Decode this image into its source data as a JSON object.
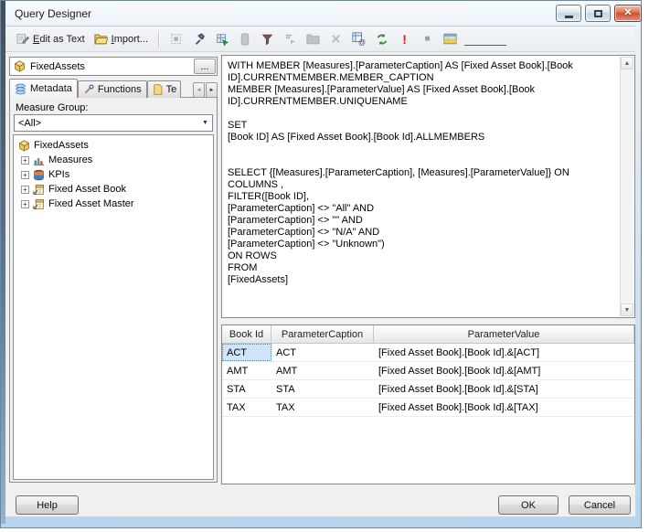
{
  "window": {
    "title": "Query Designer"
  },
  "icons": {
    "close": "✕",
    "plus": "+",
    "dropdown": "▼",
    "up": "▲",
    "down": "▼",
    "left": "◄",
    "right": "►",
    "execute": "!",
    "stop": "■",
    "ellipsis": "..."
  },
  "toolbar": {
    "edit_as_text": "Edit as Text",
    "import": "Import...",
    "icon_names": [
      "edit-as-text-icon",
      "import-folder-icon",
      "design-query-mode-icon",
      "pick-tool-icon",
      "show-empty-cells-icon",
      "add-calculated-member-icon",
      "filter-icon",
      "show-aggregations-icon",
      "group-icon",
      "delete-icon",
      "mdx-cube-icon",
      "refresh-icon",
      "execute-icon",
      "stop-icon",
      "design-mode-icon"
    ]
  },
  "cube_selector": {
    "name": "FixedAssets"
  },
  "tabs": {
    "metadata": "Metadata",
    "functions": "Functions",
    "templates": "Te"
  },
  "measure_group": {
    "label": "Measure Group:",
    "value": "<All>"
  },
  "tree": {
    "root": "FixedAssets",
    "items": [
      {
        "label": "Measures"
      },
      {
        "label": "KPIs"
      },
      {
        "label": "Fixed Asset Book"
      },
      {
        "label": "Fixed Asset Master"
      }
    ]
  },
  "query_text": "WITH MEMBER [Measures].[ParameterCaption] AS [Fixed Asset Book].[Book\nID].CURRENTMEMBER.MEMBER_CAPTION\nMEMBER [Measures].[ParameterValue] AS [Fixed Asset Book].[Book\nID].CURRENTMEMBER.UNIQUENAME\n\nSET\n[Book ID] AS [Fixed Asset Book].[Book Id].ALLMEMBERS\n\n\nSELECT {[Measures].[ParameterCaption], [Measures].[ParameterValue]} ON COLUMNS ,\nFILTER([Book ID],\n[ParameterCaption] <> \"All\" AND\n[ParameterCaption] <> \"\" AND\n[ParameterCaption] <> \"N/A\" AND\n[ParameterCaption] <> \"Unknown\")\nON ROWS\nFROM\n[FixedAssets]",
  "table": {
    "columns": [
      "Book Id",
      "ParameterCaption",
      "ParameterValue"
    ],
    "rows": [
      [
        "ACT",
        "ACT",
        "[Fixed Asset Book].[Book Id].&[ACT]"
      ],
      [
        "AMT",
        "AMT",
        "[Fixed Asset Book].[Book Id].&[AMT]"
      ],
      [
        "STA",
        "STA",
        "[Fixed Asset Book].[Book Id].&[STA]"
      ],
      [
        "TAX",
        "TAX",
        "[Fixed Asset Book].[Book Id].&[TAX]"
      ]
    ]
  },
  "buttons": {
    "help": "Help",
    "ok": "OK",
    "cancel": "Cancel"
  },
  "colors": {
    "frame_border": "#bdd7ec",
    "close_button": "#d2604a",
    "selected_cell": "#cfe4f7",
    "face": "#f0f0f0"
  }
}
